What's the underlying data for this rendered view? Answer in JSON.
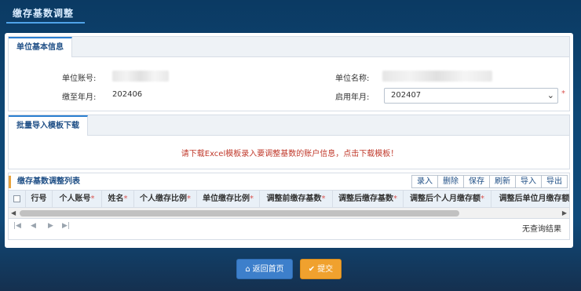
{
  "page": {
    "title": "缴存基数调整"
  },
  "basic": {
    "tab": "单位基本信息",
    "account_label": "单位账号:",
    "name_label": "单位名称:",
    "paid_until_label": "缴至年月:",
    "paid_until_value": "202406",
    "start_label": "启用年月:",
    "start_value": "202407",
    "required_mark": "*"
  },
  "download": {
    "tab": "批量导入模板下载",
    "message": "请下载Excel模板录入要调整基数的账户信息，点击下载模板！"
  },
  "grid": {
    "title": "缴存基数调整列表",
    "toolbar": [
      "录入",
      "删除",
      "保存",
      "刷新",
      "导入",
      "导出"
    ],
    "columns": [
      {
        "label": "行号",
        "required": ""
      },
      {
        "label": "个人账号",
        "required": "*"
      },
      {
        "label": "姓名",
        "required": "*"
      },
      {
        "label": "个人缴存比例",
        "required": "*"
      },
      {
        "label": "单位缴存比例",
        "required": "*"
      },
      {
        "label": "调整前缴存基数",
        "required": "*"
      },
      {
        "label": "调整后缴存基数",
        "required": "*"
      },
      {
        "label": "调整后个人月缴存额",
        "required": "*"
      },
      {
        "label": "调整后单位月缴存额",
        "required": ""
      }
    ],
    "empty_text": "无查询结果"
  },
  "actions": {
    "home": "返回首页",
    "submit": "提交"
  },
  "colors": {
    "primary": "#3d7fcb",
    "warning": "#f0a12e",
    "required": "#d9534f"
  }
}
